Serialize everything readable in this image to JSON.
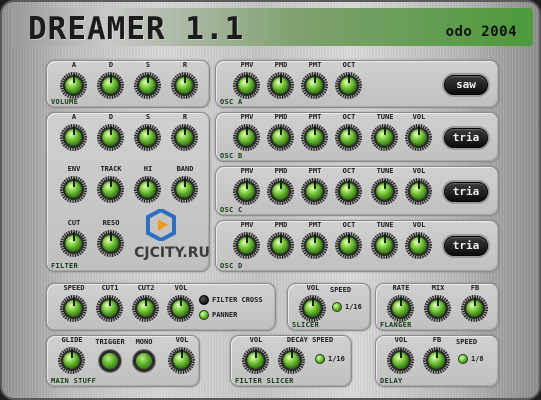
{
  "app": {
    "title": "DREAMER 1.1",
    "credit": "odo 2004"
  },
  "watermark": {
    "text": "CJCITY.RU"
  },
  "panels": {
    "volume": {
      "label": "VOLUME",
      "knobs": [
        "A",
        "D",
        "S",
        "R"
      ]
    },
    "filter": {
      "label": "FILTER",
      "knobs_row1": [
        "A",
        "D",
        "S",
        "R"
      ],
      "knobs_row2": [
        "ENV",
        "TRACK",
        "HI",
        "BAND"
      ],
      "knobs_row3": [
        "CUT",
        "RESO"
      ]
    },
    "osc_a": {
      "label": "OSC A",
      "knobs": [
        "PMV",
        "PMD",
        "PMT",
        "OCT"
      ],
      "wave": "saw"
    },
    "osc_b": {
      "label": "OSC B",
      "knobs": [
        "PMV",
        "PMD",
        "PMT",
        "OCT",
        "TUNE",
        "VOL"
      ],
      "wave": "tria"
    },
    "osc_c": {
      "label": "OSC C",
      "knobs": [
        "PMV",
        "PMD",
        "PMT",
        "OCT",
        "TUNE",
        "VOL"
      ],
      "wave": "tria"
    },
    "osc_d": {
      "label": "OSC D",
      "knobs": [
        "PMV",
        "PMD",
        "PMT",
        "OCT",
        "TUNE",
        "VOL"
      ],
      "wave": "tria"
    },
    "lfo": {
      "knobs": [
        "SPEED",
        "CUT1",
        "CUT2",
        "VOL"
      ],
      "options": [
        "FILTER CROSS",
        "PANNER"
      ]
    },
    "slicer": {
      "label": "SLICER",
      "knobs": [
        "VOL",
        "SPEED"
      ],
      "option": "1/16"
    },
    "flanger": {
      "label": "FLANGER",
      "knobs": [
        "RATE",
        "MIX",
        "FB"
      ]
    },
    "main": {
      "label": "MAIN STUFF",
      "controls": [
        "GLIDE",
        "TRIGGER",
        "MONO",
        "VOL"
      ]
    },
    "filter_slicer": {
      "label": "FILTER SLICER",
      "knobs": [
        "VOL",
        "DECAY SPEED"
      ],
      "option": "1/16"
    },
    "delay": {
      "label": "DELAY",
      "knobs": [
        "VOL",
        "FB",
        "SPEED"
      ],
      "option": "1/8"
    }
  }
}
